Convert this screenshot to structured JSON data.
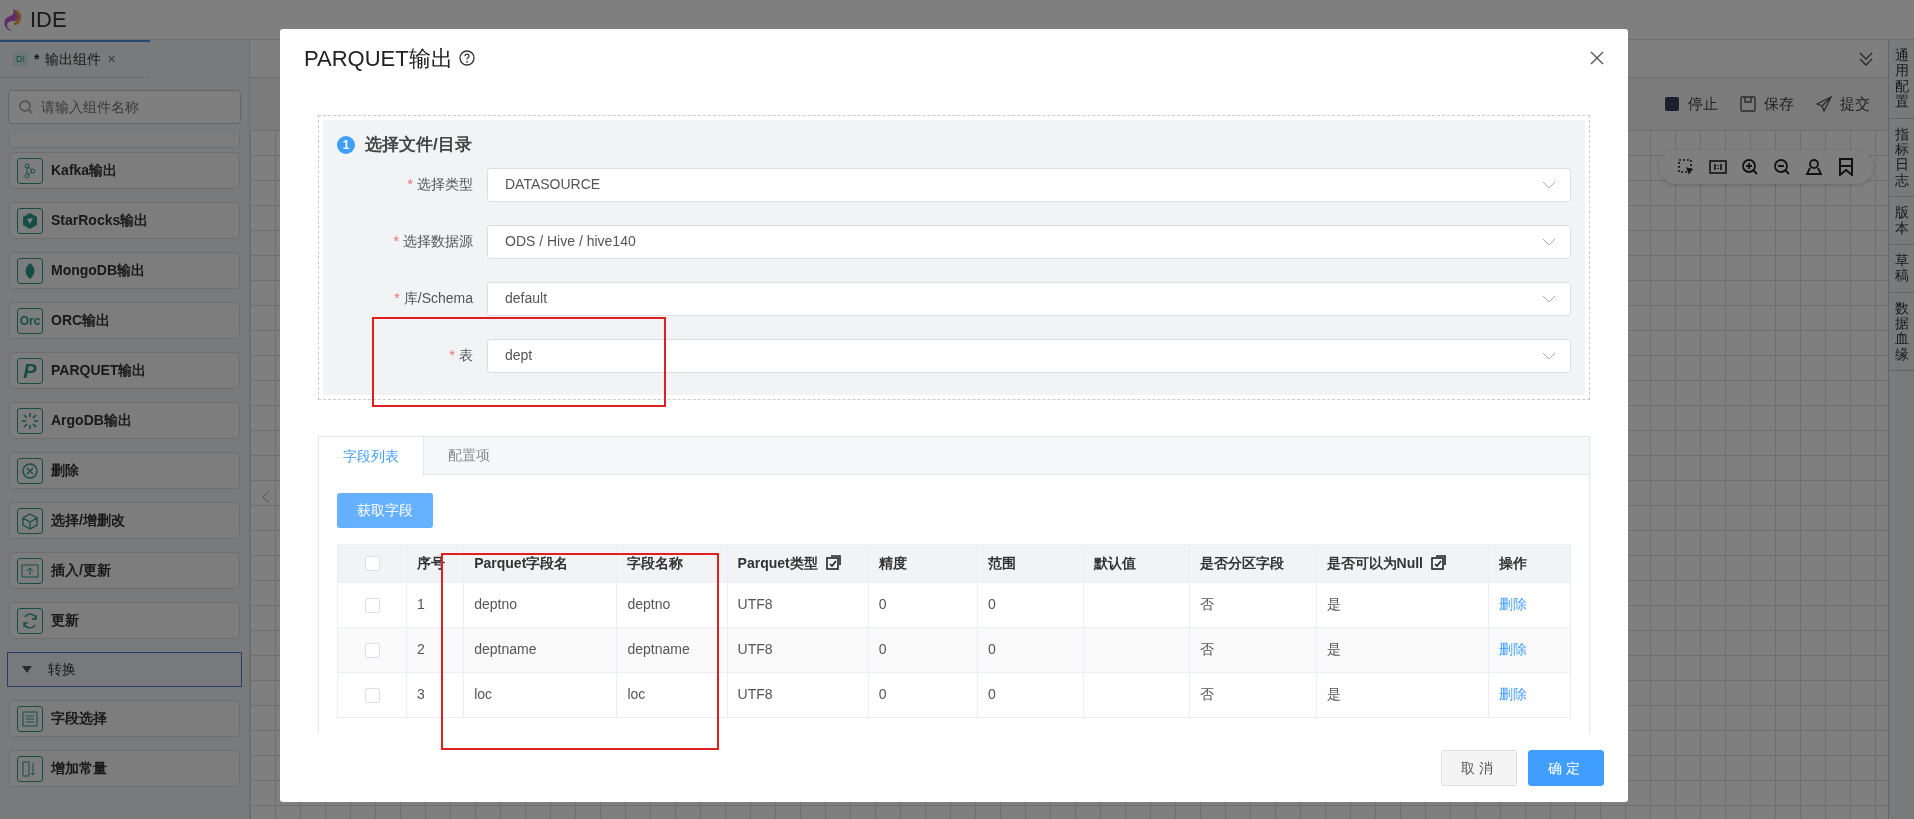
{
  "app": {
    "title": "IDE"
  },
  "editor_tab": {
    "badge": "DI",
    "modified_mark": "*",
    "label": "输出组件",
    "close": "×"
  },
  "sidebar": {
    "search_placeholder": "请输入组件名称",
    "items": [
      {
        "kind": "item",
        "label": "Kafka输出"
      },
      {
        "kind": "item",
        "label": "StarRocks输出"
      },
      {
        "kind": "item",
        "label": "MongoDB输出"
      },
      {
        "kind": "text_icon",
        "icon_text": "Orc",
        "label": "ORC输出"
      },
      {
        "kind": "text_icon",
        "icon_text": "P",
        "label": "PARQUET输出"
      },
      {
        "kind": "item",
        "label": "ArgoDB输出"
      },
      {
        "kind": "item",
        "label": "删除"
      },
      {
        "kind": "item",
        "label": "选择/增删改"
      },
      {
        "kind": "item",
        "label": "插入/更新"
      },
      {
        "kind": "item",
        "label": "更新"
      },
      {
        "kind": "group",
        "label": "转换",
        "expanded": true
      },
      {
        "kind": "item",
        "label": "字段选择"
      },
      {
        "kind": "item",
        "label": "增加常量"
      }
    ]
  },
  "toolbar": {
    "actions": [
      {
        "label": "停止"
      },
      {
        "label": "保存"
      },
      {
        "label": "提交"
      }
    ]
  },
  "right_tabs": [
    "通用配置",
    "指标日志",
    "版本",
    "草稿",
    "数据血缘"
  ],
  "dialog": {
    "title": "PARQUET输出",
    "section": {
      "number": "1",
      "title": "选择文件/目录",
      "fields": [
        {
          "required_mark": "*",
          "label": "选择类型",
          "value": "DATASOURCE"
        },
        {
          "required_mark": "*",
          "label": "选择数据源",
          "value": "ODS / Hive / hive140"
        },
        {
          "required_mark": "*",
          "label": "库/Schema",
          "value": "default"
        },
        {
          "required_mark": "*",
          "label": "表",
          "value": "dept"
        }
      ]
    },
    "tabs": [
      {
        "label": "字段列表",
        "selected": true
      },
      {
        "label": "配置项",
        "selected": false
      }
    ],
    "fetch_button": "获取字段",
    "table": {
      "all_selected": false,
      "columns": [
        {
          "label": "序号",
          "batch_edit": false
        },
        {
          "label": "Parquet字段名",
          "batch_edit": false
        },
        {
          "label": "字段名称",
          "batch_edit": false
        },
        {
          "label": "Parquet类型",
          "batch_edit": true
        },
        {
          "label": "精度",
          "batch_edit": false
        },
        {
          "label": "范围",
          "batch_edit": false
        },
        {
          "label": "默认值",
          "batch_edit": false
        },
        {
          "label": "是否分区字段",
          "batch_edit": false
        },
        {
          "label": "是否可以为Null",
          "batch_edit": true
        },
        {
          "label": "操作",
          "batch_edit": false
        }
      ],
      "rows": [
        {
          "selected": false,
          "index": "1",
          "parquet_name": "deptno",
          "field_name": "deptno",
          "parquet_type": "UTF8",
          "precision": "0",
          "range": "0",
          "partition": "否",
          "nullable": "是",
          "action": "删除"
        },
        {
          "selected": false,
          "index": "2",
          "parquet_name": "deptname",
          "field_name": "deptname",
          "parquet_type": "UTF8",
          "precision": "0",
          "range": "0",
          "partition": "否",
          "nullable": "是",
          "action": "删除"
        },
        {
          "selected": false,
          "index": "3",
          "parquet_name": "loc",
          "field_name": "loc",
          "parquet_type": "UTF8",
          "precision": "0",
          "range": "0",
          "partition": "否",
          "nullable": "是",
          "action": "删除"
        }
      ]
    },
    "buttons": [
      {
        "label": "取消",
        "kind": "secondary"
      },
      {
        "label": "确定",
        "kind": "primary"
      }
    ]
  },
  "annotations": [
    {
      "kind": "red_box"
    },
    {
      "kind": "red_box"
    }
  ]
}
